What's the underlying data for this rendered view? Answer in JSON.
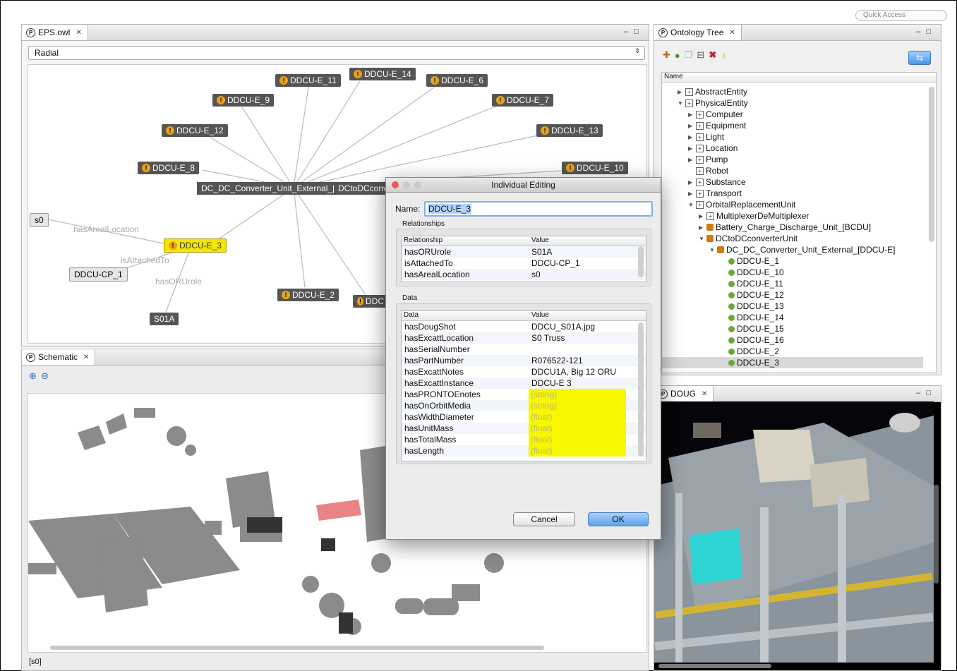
{
  "top_right": {
    "quick_access": "Quick Access"
  },
  "eps_panel": {
    "tab_label": "EPS.owl",
    "layout_select": "Radial",
    "nodes": {
      "center": "DC_DC_Converter_Unit_External_[",
      "center2": "DCtoDCconv",
      "e11": "DDCU-E_11",
      "e14": "DDCU-E_14",
      "e6": "DDCU-E_6",
      "e9": "DDCU-E_9",
      "e7": "DDCU-E_7",
      "e12": "DDCU-E_12",
      "e13": "DDCU-E_13",
      "e8": "DDCU-E_8",
      "e10": "DDCU-E_10",
      "e3": "DDCU-E_3",
      "e2": "DDCU-E_2",
      "eX": "DDC",
      "s0": "s0",
      "cp1": "DDCU-CP_1",
      "s01a": "S01A"
    },
    "edge_labels": {
      "areal": "hasArealLocation",
      "attached": "isAttachedTo",
      "orurole": "hasORUrole"
    }
  },
  "ontology_panel": {
    "tab_label": "Ontology Tree",
    "column_name": "Name",
    "tree": [
      {
        "label": "AbstractEntity"
      },
      {
        "label": "PhysicalEntity"
      },
      {
        "label": "Computer"
      },
      {
        "label": "Equipment"
      },
      {
        "label": "Light"
      },
      {
        "label": "Location"
      },
      {
        "label": "Pump"
      },
      {
        "label": "Robot"
      },
      {
        "label": "Substance"
      },
      {
        "label": "Transport"
      },
      {
        "label": "OrbitalReplacementUnit"
      },
      {
        "label": "MultiplexerDeMultiplexer"
      },
      {
        "label": "Battery_Charge_Discharge_Unit_[BCDU]"
      },
      {
        "label": "DCtoDCconverterUnit"
      },
      {
        "label": "DC_DC_Converter_Unit_External_[DDCU-E]"
      },
      {
        "label": "DDCU-E_1"
      },
      {
        "label": "DDCU-E_10"
      },
      {
        "label": "DDCU-E_11"
      },
      {
        "label": "DDCU-E_12"
      },
      {
        "label": "DDCU-E_13"
      },
      {
        "label": "DDCU-E_14"
      },
      {
        "label": "DDCU-E_15"
      },
      {
        "label": "DDCU-E_16"
      },
      {
        "label": "DDCU-E_2"
      },
      {
        "label": "DDCU-E_3"
      }
    ]
  },
  "schematic_panel": {
    "tab_label": "Schematic",
    "status": "[s0]"
  },
  "doug_panel": {
    "tab_label": "DOUG"
  },
  "dialog": {
    "title": "Individual Editing",
    "name_label": "Name:",
    "name_value": "DDCU-E_3",
    "relationships_label": "Relationships",
    "rel_headers": [
      "Relationship",
      "Value"
    ],
    "relationships": [
      {
        "key": "hasORUrole",
        "value": "S01A"
      },
      {
        "key": "isAttachedTo",
        "value": "DDCU-CP_1"
      },
      {
        "key": "hasArealLocation",
        "value": "s0"
      }
    ],
    "data_label": "Data",
    "data_headers": [
      "Data",
      "Value"
    ],
    "data": [
      {
        "key": "hasDougShot",
        "value": "DDCU_S01A.jpg"
      },
      {
        "key": "hasExcattLocation",
        "value": "S0 Truss"
      },
      {
        "key": "hasSerialNumber",
        "value": ""
      },
      {
        "key": "hasPartNumber",
        "value": "R076522-121"
      },
      {
        "key": "hasExcattNotes",
        "value": "DDCU1A, Big 12 ORU"
      },
      {
        "key": "hasExcattInstance",
        "value": "DDCU-E 3"
      },
      {
        "key": "hasPRONTOEnotes",
        "value": "(string)"
      },
      {
        "key": "hasOnOrbitMedia",
        "value": "(string)"
      },
      {
        "key": "hasWidthDiameter",
        "value": "(float)"
      },
      {
        "key": "hasUnitMass",
        "value": "(float)"
      },
      {
        "key": "hasTotalMass",
        "value": "(float)"
      },
      {
        "key": "hasLength",
        "value": "(float)"
      }
    ],
    "cancel": "Cancel",
    "ok": "OK"
  }
}
